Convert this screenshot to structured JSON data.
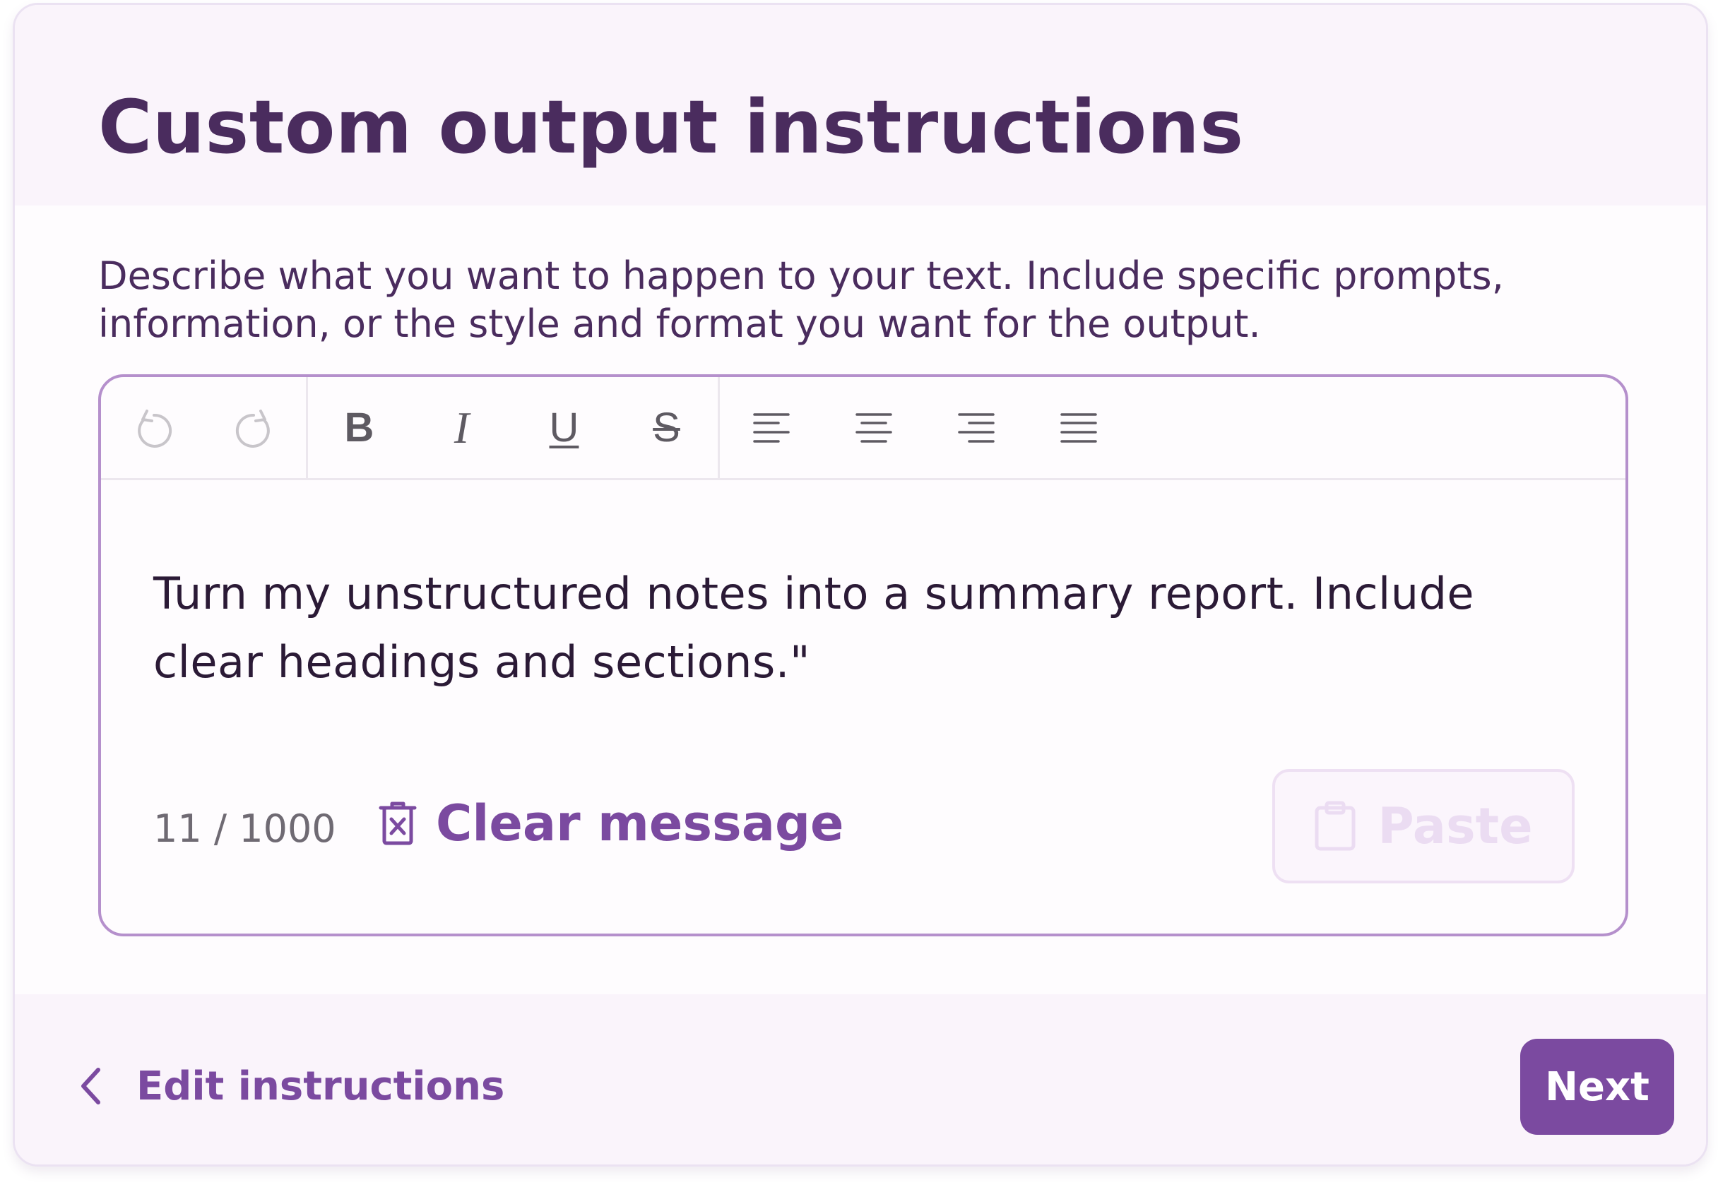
{
  "header": {
    "title": "Custom output instructions"
  },
  "description": "Describe what you want to happen to your text. Include specific prompts, information, or the style and format you want for the output.",
  "toolbar": {
    "bold_label": "B",
    "italic_label": "I",
    "underline_label": "U",
    "strike_label": "S"
  },
  "editor": {
    "message": "Turn my unstructured notes into a summary report. Include clear headings and sections.\"",
    "counter": "11 / 1000",
    "clear_label": "Clear message",
    "paste_label": "Paste"
  },
  "footer": {
    "back_label": "Edit instructions",
    "next_label": "Next"
  },
  "colors": {
    "accent": "#7b4aa0",
    "title": "#4a2c5e",
    "editor_border": "#b590cc",
    "header_bg": "#faf4fb"
  }
}
